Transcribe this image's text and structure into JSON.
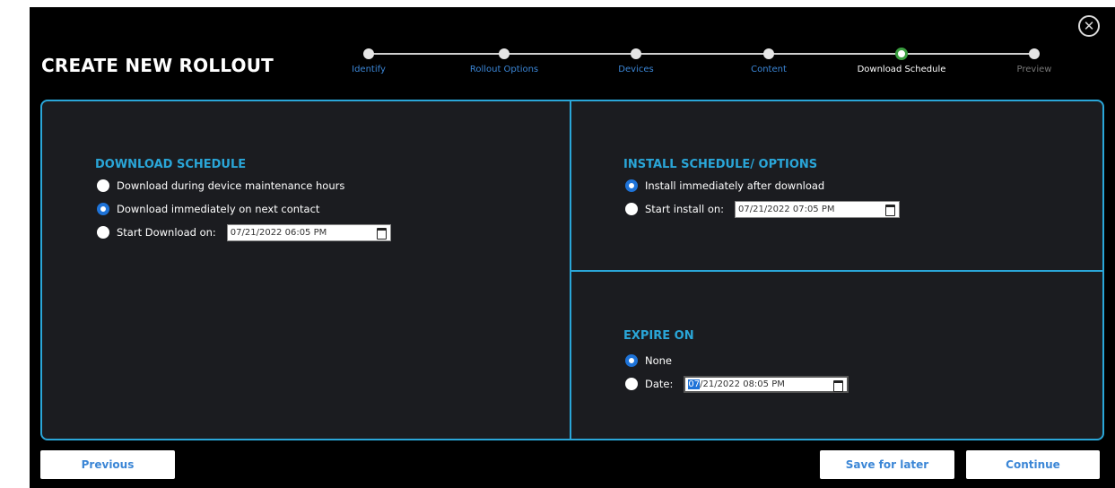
{
  "header": {
    "title": "CREATE NEW ROLLOUT",
    "close_icon": "close-circle-icon"
  },
  "stepper": {
    "steps": [
      {
        "label": "Identify",
        "state": "done"
      },
      {
        "label": "Rollout Options",
        "state": "done"
      },
      {
        "label": "Devices",
        "state": "done"
      },
      {
        "label": "Content",
        "state": "done"
      },
      {
        "label": "Download Schedule",
        "state": "current"
      },
      {
        "label": "Preview",
        "state": "future"
      }
    ]
  },
  "download_schedule": {
    "title": "DOWNLOAD SCHEDULE",
    "options": [
      {
        "label": "Download during device maintenance hours",
        "checked": false
      },
      {
        "label": "Download immediately on next contact",
        "checked": true
      },
      {
        "label": "Start Download on:",
        "checked": false,
        "datetime": "07/21/2022 06:05 PM"
      }
    ]
  },
  "install_schedule": {
    "title": "INSTALL SCHEDULE/ OPTIONS",
    "options": [
      {
        "label": "Install immediately after download",
        "checked": true
      },
      {
        "label": "Start install on:",
        "checked": false,
        "datetime": "07/21/2022 07:05 PM"
      }
    ]
  },
  "expire_on": {
    "title": "EXPIRE ON",
    "options": [
      {
        "label": "None",
        "checked": true
      },
      {
        "label": "Date:",
        "checked": false,
        "datetime_selected": "07",
        "datetime_rest": "/21/2022 08:05 PM"
      }
    ]
  },
  "footer": {
    "previous": "Previous",
    "save_for_later": "Save for later",
    "continue": "Continue"
  },
  "colors": {
    "accent": "#2aa6d8",
    "radio_checked": "#1e73d8",
    "step_active_ring": "#3a9e3f",
    "panel_bg": "#1b1c20"
  }
}
